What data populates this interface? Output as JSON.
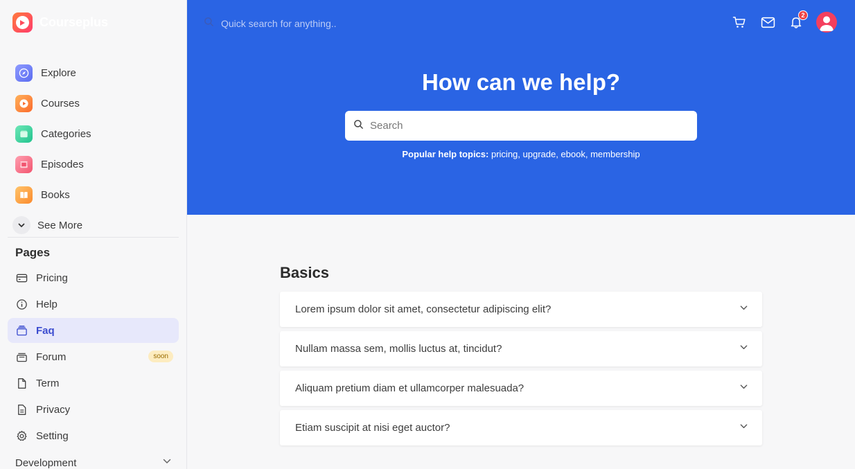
{
  "brand": {
    "name": "Courseplus"
  },
  "sidebar": {
    "main_items": [
      {
        "label": "Explore",
        "icon": "compass-icon",
        "color": "#6b7cf6"
      },
      {
        "label": "Courses",
        "icon": "play-icon",
        "color": "#fb8c3c"
      },
      {
        "label": "Categories",
        "icon": "folder-icon",
        "color": "#34d399"
      },
      {
        "label": "Episodes",
        "icon": "film-icon",
        "color": "#fb6f8a"
      },
      {
        "label": "Books",
        "icon": "book-icon",
        "color": "#fbad3c"
      }
    ],
    "see_more": "See More",
    "pages_title": "Pages",
    "pages": [
      {
        "label": "Pricing",
        "icon": "credit-card-icon"
      },
      {
        "label": "Help",
        "icon": "info-icon"
      },
      {
        "label": "Faq",
        "icon": "layers-icon",
        "active": true
      },
      {
        "label": "Forum",
        "icon": "archive-icon",
        "badge": "soon"
      },
      {
        "label": "Term",
        "icon": "document-icon"
      },
      {
        "label": "Privacy",
        "icon": "document-text-icon"
      },
      {
        "label": "Setting",
        "icon": "gear-icon"
      }
    ],
    "development": "Development"
  },
  "topbar": {
    "search_placeholder": "Quick search for anything..",
    "notification_count": "2"
  },
  "hero": {
    "title": "How can we help?",
    "search_placeholder": "Search",
    "popular_label": "Popular help topics:",
    "popular_topics": "pricing, upgrade, ebook, membership",
    "bg_color": "#2a64e4"
  },
  "faq": {
    "section_title": "Basics",
    "questions": [
      "Lorem ipsum dolor sit amet, consectetur adipiscing elit?",
      "Nullam massa sem, mollis luctus at, tincidut?",
      "Aliquam pretium diam et ullamcorper malesuada?",
      "Etiam suscipit at nisi eget auctor?"
    ]
  }
}
